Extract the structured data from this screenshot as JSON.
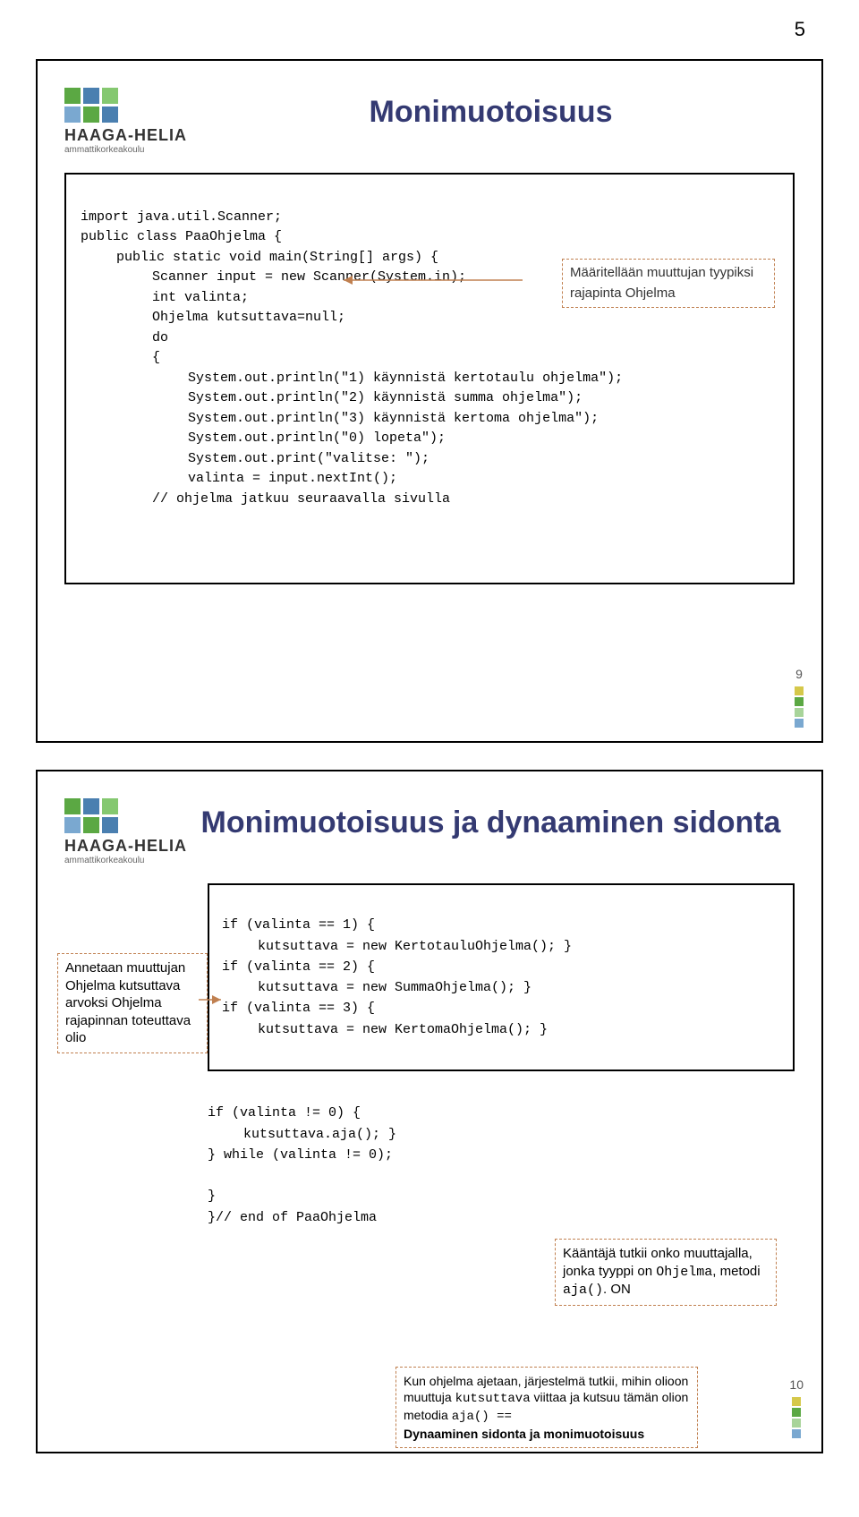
{
  "page_number_top": "5",
  "logo": {
    "name": "HAAGA-HELIA",
    "sub": "ammattikorkeakoulu"
  },
  "slide1": {
    "title": "Monimuotoisuus",
    "code": {
      "l1": "import java.util.Scanner;",
      "l2": "public class PaaOhjelma {",
      "l3": "public static void main(String[] args) {",
      "l4": "Scanner input = new Scanner(System.in);",
      "l5": "int valinta;",
      "l6": "Ohjelma kutsuttava=null;",
      "l7": "do",
      "l8": "{",
      "l9": "System.out.println(\"1) käynnistä kertotaulu ohjelma\");",
      "l10": "System.out.println(\"2) käynnistä summa ohjelma\");",
      "l11": "System.out.println(\"3) käynnistä kertoma ohjelma\");",
      "l12": "System.out.println(\"0) lopeta\");",
      "l13": "System.out.print(\"valitse: \");",
      "l14": "valinta = input.nextInt();",
      "l15": "// ohjelma jatkuu seuraavalla sivulla"
    },
    "callout": "Määritellään muuttujan tyypiksi rajapinta Ohjelma",
    "num": "9"
  },
  "slide2": {
    "title": "Monimuotoisuus ja dynaaminen sidonta",
    "left_callout": "Annetaan muuttujan Ohjelma kutsuttava arvoksi Ohjelma rajapinnan toteuttava olio",
    "code": {
      "l1": "if (valinta == 1) {",
      "l2": "kutsuttava = new KertotauluOhjelma(); }",
      "l3": "if (valinta == 2) {",
      "l4": "kutsuttava = new SummaOhjelma(); }",
      "l5": "if (valinta == 3) {",
      "l6": "kutsuttava = new KertomaOhjelma(); }"
    },
    "below": {
      "l1": "if (valinta != 0) {",
      "l2": "kutsuttava.aja(); }",
      "l3": "} while (valinta != 0);",
      "l4": "}",
      "l5": "}// end of PaaOhjelma"
    },
    "call1_line1": "Kääntäjä tutkii onko muuttajalla, jonka tyyppi on ",
    "call1_code1": "Ohjelma",
    "call1_mid": ", metodi ",
    "call1_code2": "aja()",
    "call1_end": ". ON",
    "call2_pre": "Kun ohjelma ajetaan, järjestelmä tutkii, mihin olioon muuttuja ",
    "call2_code1": "kutsuttava",
    "call2_mid": " viittaa ja kutsuu tämän olion metodia ",
    "call2_code2": "aja() ==",
    "call2_bold": "Dynaaminen sidonta ja monimuotoisuus",
    "num": "10"
  }
}
